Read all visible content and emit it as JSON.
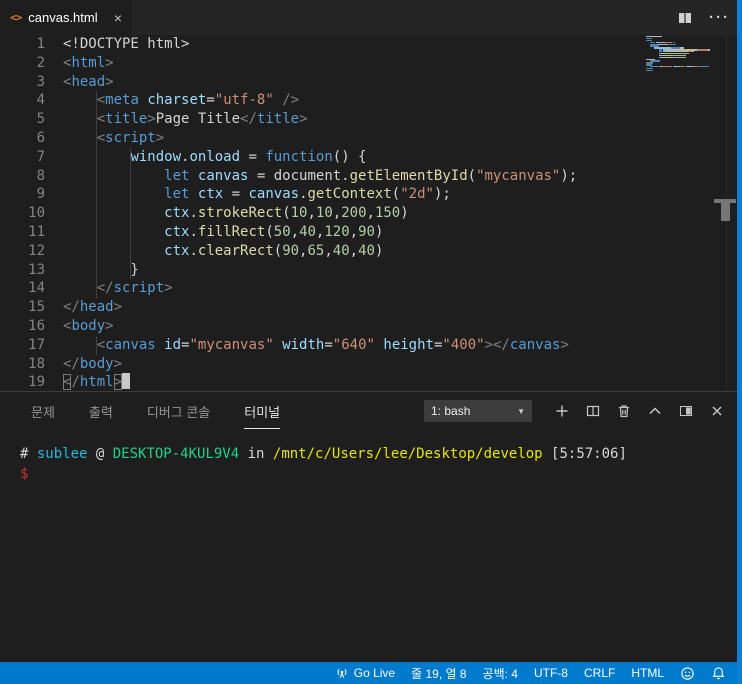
{
  "colors": {
    "accent": "#007acc",
    "editor_bg": "#1e1e1e",
    "tabbar_bg": "#252526",
    "html_icon": "#e37933"
  },
  "tab": {
    "filename": "canvas.html",
    "close_glyph": "×"
  },
  "editor_actions": {
    "more_glyph": "···"
  },
  "code": {
    "lines": [
      {
        "n": "1",
        "seg": [
          [
            "p",
            "<!DOCTYPE html>"
          ]
        ]
      },
      {
        "n": "2",
        "seg": [
          [
            "g",
            "<"
          ],
          [
            "t",
            "html"
          ],
          [
            "g",
            ">"
          ]
        ]
      },
      {
        "n": "3",
        "seg": [
          [
            "g",
            "<"
          ],
          [
            "t",
            "head"
          ],
          [
            "g",
            ">"
          ]
        ]
      },
      {
        "n": "4",
        "seg": [
          [
            "p",
            "    "
          ],
          [
            "g",
            "<"
          ],
          [
            "t",
            "meta"
          ],
          [
            "p",
            " "
          ],
          [
            "a",
            "charset"
          ],
          [
            "p",
            "="
          ],
          [
            "s",
            "\"utf-8\""
          ],
          [
            "p",
            " "
          ],
          [
            "g",
            "/>"
          ]
        ]
      },
      {
        "n": "5",
        "seg": [
          [
            "p",
            "    "
          ],
          [
            "g",
            "<"
          ],
          [
            "t",
            "title"
          ],
          [
            "g",
            ">"
          ],
          [
            "p",
            "Page Title"
          ],
          [
            "g",
            "</"
          ],
          [
            "t",
            "title"
          ],
          [
            "g",
            ">"
          ]
        ]
      },
      {
        "n": "6",
        "seg": [
          [
            "p",
            "    "
          ],
          [
            "g",
            "<"
          ],
          [
            "t",
            "script"
          ],
          [
            "g",
            ">"
          ]
        ]
      },
      {
        "n": "7",
        "seg": [
          [
            "p",
            "        "
          ],
          [
            "a",
            "window"
          ],
          [
            "p",
            "."
          ],
          [
            "a",
            "onload"
          ],
          [
            "p",
            " = "
          ],
          [
            "t",
            "function"
          ],
          [
            "p",
            "() {"
          ]
        ]
      },
      {
        "n": "8",
        "seg": [
          [
            "p",
            "            "
          ],
          [
            "t",
            "let"
          ],
          [
            "p",
            " "
          ],
          [
            "a",
            "canvas"
          ],
          [
            "p",
            " = document."
          ],
          [
            "f",
            "getElementById"
          ],
          [
            "p",
            "("
          ],
          [
            "s",
            "\"mycanvas\""
          ],
          [
            "p",
            ");"
          ]
        ]
      },
      {
        "n": "9",
        "seg": [
          [
            "p",
            "            "
          ],
          [
            "t",
            "let"
          ],
          [
            "p",
            " "
          ],
          [
            "a",
            "ctx"
          ],
          [
            "p",
            " = "
          ],
          [
            "a",
            "canvas"
          ],
          [
            "p",
            "."
          ],
          [
            "f",
            "getContext"
          ],
          [
            "p",
            "("
          ],
          [
            "s",
            "\"2d\""
          ],
          [
            "p",
            ");"
          ]
        ]
      },
      {
        "n": "10",
        "seg": [
          [
            "p",
            "            "
          ],
          [
            "a",
            "ctx"
          ],
          [
            "p",
            "."
          ],
          [
            "f",
            "strokeRect"
          ],
          [
            "p",
            "("
          ],
          [
            "n",
            "10"
          ],
          [
            "p",
            ","
          ],
          [
            "n",
            "10"
          ],
          [
            "p",
            ","
          ],
          [
            "n",
            "200"
          ],
          [
            "p",
            ","
          ],
          [
            "n",
            "150"
          ],
          [
            "p",
            ")"
          ]
        ]
      },
      {
        "n": "11",
        "seg": [
          [
            "p",
            "            "
          ],
          [
            "a",
            "ctx"
          ],
          [
            "p",
            "."
          ],
          [
            "f",
            "fillRect"
          ],
          [
            "p",
            "("
          ],
          [
            "n",
            "50"
          ],
          [
            "p",
            ","
          ],
          [
            "n",
            "40"
          ],
          [
            "p",
            ","
          ],
          [
            "n",
            "120"
          ],
          [
            "p",
            ","
          ],
          [
            "n",
            "90"
          ],
          [
            "p",
            ")"
          ]
        ]
      },
      {
        "n": "12",
        "seg": [
          [
            "p",
            "            "
          ],
          [
            "a",
            "ctx"
          ],
          [
            "p",
            "."
          ],
          [
            "f",
            "clearRect"
          ],
          [
            "p",
            "("
          ],
          [
            "n",
            "90"
          ],
          [
            "p",
            ","
          ],
          [
            "n",
            "65"
          ],
          [
            "p",
            ","
          ],
          [
            "n",
            "40"
          ],
          [
            "p",
            ","
          ],
          [
            "n",
            "40"
          ],
          [
            "p",
            ")"
          ]
        ]
      },
      {
        "n": "13",
        "seg": [
          [
            "p",
            "        }"
          ]
        ]
      },
      {
        "n": "14",
        "seg": [
          [
            "p",
            "    "
          ],
          [
            "g",
            "</"
          ],
          [
            "t",
            "script"
          ],
          [
            "g",
            ">"
          ]
        ]
      },
      {
        "n": "15",
        "seg": [
          [
            "g",
            "</"
          ],
          [
            "t",
            "head"
          ],
          [
            "g",
            ">"
          ]
        ]
      },
      {
        "n": "16",
        "seg": [
          [
            "g",
            "<"
          ],
          [
            "t",
            "body"
          ],
          [
            "g",
            ">"
          ]
        ]
      },
      {
        "n": "17",
        "seg": [
          [
            "p",
            "    "
          ],
          [
            "g",
            "<"
          ],
          [
            "t",
            "canvas"
          ],
          [
            "p",
            " "
          ],
          [
            "a",
            "id"
          ],
          [
            "p",
            "="
          ],
          [
            "s",
            "\"mycanvas\""
          ],
          [
            "p",
            " "
          ],
          [
            "a",
            "width"
          ],
          [
            "p",
            "="
          ],
          [
            "s",
            "\"640\""
          ],
          [
            "p",
            " "
          ],
          [
            "a",
            "height"
          ],
          [
            "p",
            "="
          ],
          [
            "s",
            "\"400\""
          ],
          [
            "g",
            "></"
          ],
          [
            "t",
            "canvas"
          ],
          [
            "g",
            ">"
          ]
        ]
      },
      {
        "n": "18",
        "seg": [
          [
            "g",
            "</"
          ],
          [
            "t",
            "body"
          ],
          [
            "g",
            ">"
          ]
        ]
      },
      {
        "n": "19",
        "seg": [
          [
            "g bm",
            "<"
          ],
          [
            "g",
            "/"
          ],
          [
            "t",
            "html"
          ],
          [
            "g bm",
            ">"
          ]
        ],
        "cursor": true
      }
    ]
  },
  "panel": {
    "tabs": [
      {
        "label": "문제",
        "active": false
      },
      {
        "label": "출력",
        "active": false
      },
      {
        "label": "디버그 콘솔",
        "active": false
      },
      {
        "label": "터미널",
        "active": true
      }
    ],
    "terminal": {
      "select_label": "1: bash",
      "select_arrow": "▼",
      "lines": [
        {
          "seg": [
            [
              "w",
              "# "
            ],
            [
              "c",
              "sublee"
            ],
            [
              "w",
              " @ "
            ],
            [
              "g",
              "DESKTOP-4KUL9V4"
            ],
            [
              "w",
              " in "
            ],
            [
              "y",
              "/mnt/c/Users/lee/Desktop/develop"
            ],
            [
              "w",
              " [5:57:06]"
            ]
          ]
        },
        {
          "seg": [
            [
              "r",
              "$"
            ]
          ]
        }
      ]
    }
  },
  "status_bar": {
    "go_live": "Go Live",
    "cursor_position": "줄 19, 열 8",
    "indentation": "공백: 4",
    "encoding": "UTF-8",
    "eol": "CRLF",
    "language": "HTML"
  }
}
